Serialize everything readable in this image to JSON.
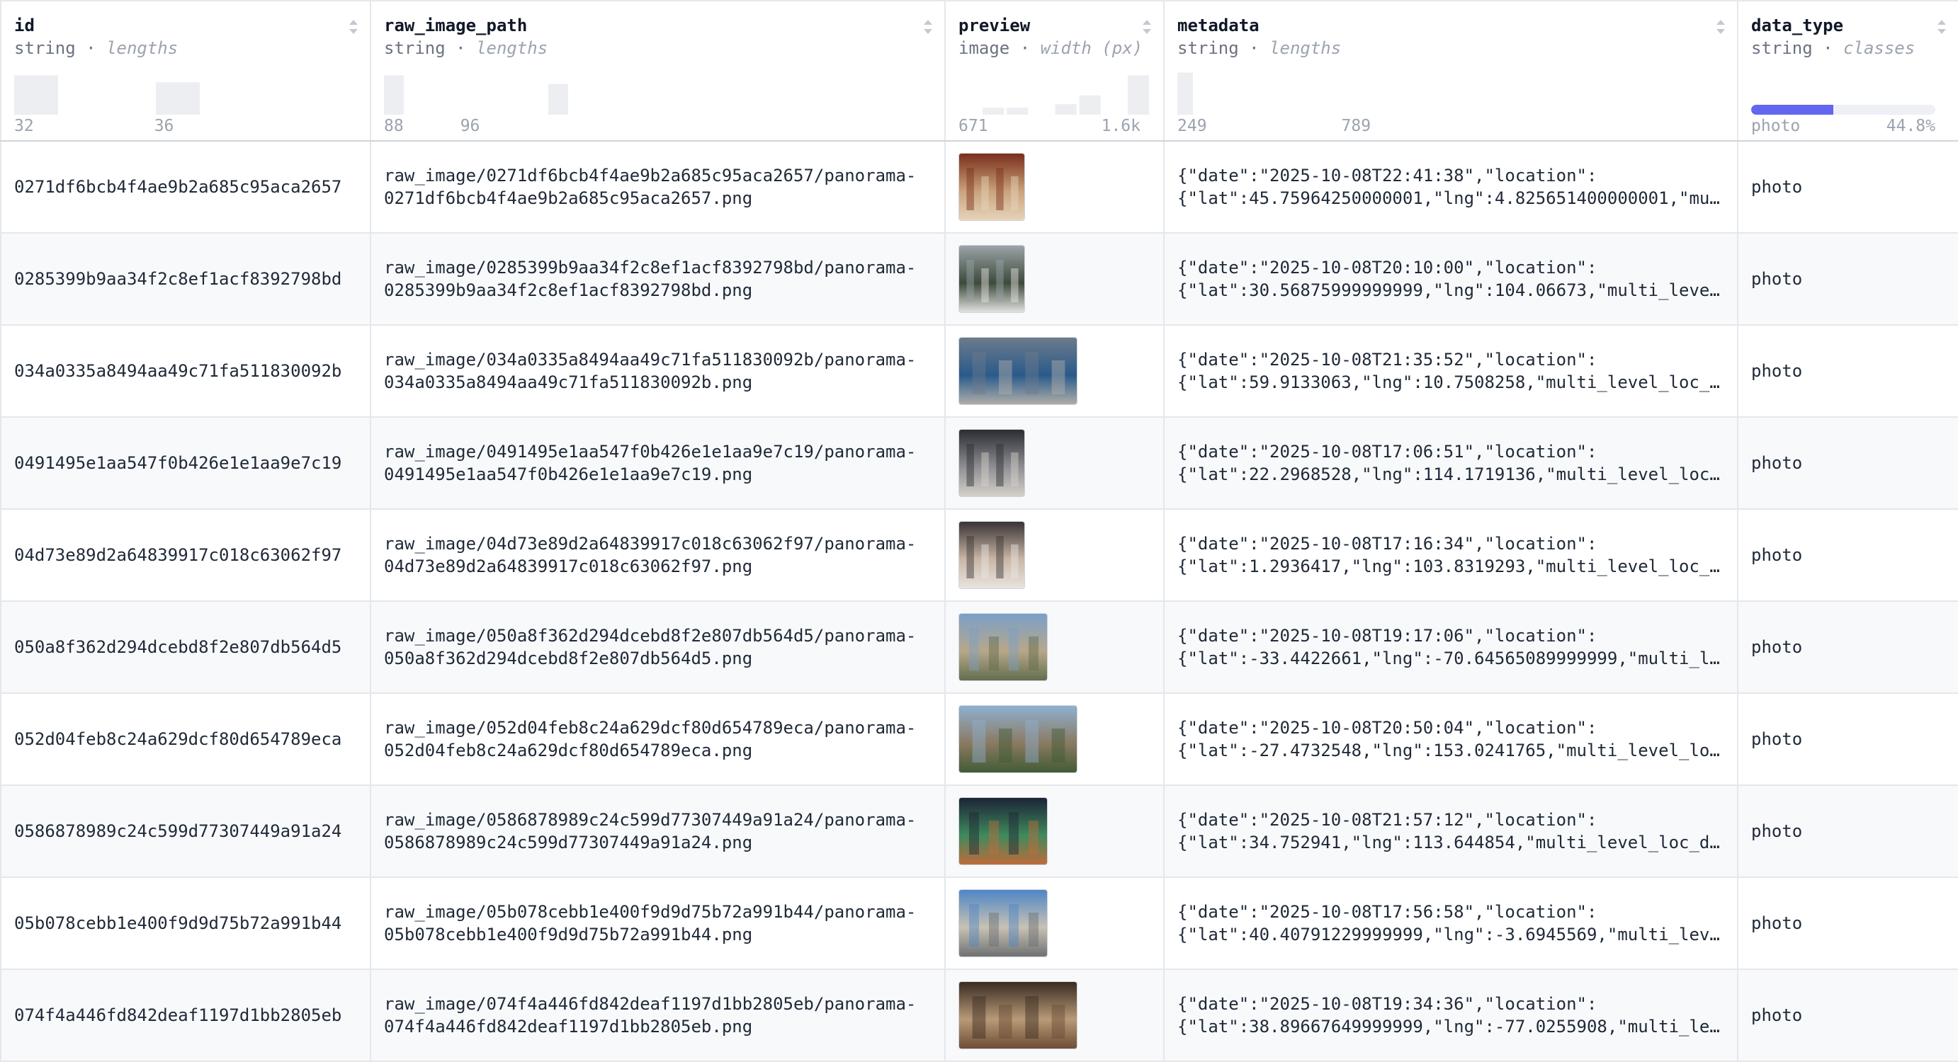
{
  "columns": [
    {
      "name": "id",
      "type": "string",
      "stat": "lengths",
      "min": "32",
      "max": "36"
    },
    {
      "name": "raw_image_path",
      "type": "string",
      "stat": "lengths",
      "min": "88",
      "max": "96"
    },
    {
      "name": "preview",
      "type": "image",
      "stat": "width (px)",
      "min": "671",
      "max": "1.6k"
    },
    {
      "name": "metadata",
      "type": "string",
      "stat": "lengths",
      "min": "249",
      "max": "789"
    },
    {
      "name": "data_type",
      "type": "string",
      "stat": "classes",
      "min": "photo",
      "max": "44.8%",
      "fraction": 0.448
    }
  ],
  "histograms": {
    "id": [
      0.45,
      0.0,
      0.0,
      0.0,
      0.0,
      0.0,
      0.0,
      0.37
    ],
    "raw_image_path": [
      0.45,
      0.0,
      0.0,
      0.0,
      0.0,
      0.0,
      0.0,
      0.0,
      0.0,
      0.35
    ],
    "preview": [
      0.0,
      0.08,
      0.08,
      0.0,
      0.12,
      0.22,
      0.0,
      0.45
    ],
    "metadata": [
      0.48
    ]
  },
  "rows": [
    {
      "id": "0271df6bcb4f4ae9b2a685c95aca2657",
      "path_1": "raw_image/0271df6bcb4f4ae9b2a685c95aca2657/panorama-",
      "path_2": "0271df6bcb4f4ae9b2a685c95aca2657.png",
      "meta_1": "{\"date\":\"2025-10-08T22:41:38\",\"location\":",
      "meta_2": "{\"lat\":45.75964250000001,\"lng\":4.825651400000001,\"mu…",
      "type": "photo",
      "thumb_w": 0.56,
      "thumb_colors": [
        "#7a2e1c",
        "#c9a27a",
        "#e7d6bd"
      ]
    },
    {
      "id": "0285399b9aa34f2c8ef1acf8392798bd",
      "path_1": "raw_image/0285399b9aa34f2c8ef1acf8392798bd/panorama-",
      "path_2": "0285399b9aa34f2c8ef1acf8392798bd.png",
      "meta_1": "{\"date\":\"2025-10-08T20:10:00\",\"location\":",
      "meta_2": "{\"lat\":30.56875999999999,\"lng\":104.06673,\"multi_leve…",
      "type": "photo",
      "thumb_w": 0.56,
      "thumb_colors": [
        "#9aa3a8",
        "#3d4a3a",
        "#e8e9e6"
      ]
    },
    {
      "id": "034a0335a8494aa49c71fa511830092b",
      "path_1": "raw_image/034a0335a8494aa49c71fa511830092b/panorama-",
      "path_2": "034a0335a8494aa49c71fa511830092b.png",
      "meta_1": "{\"date\":\"2025-10-08T21:35:52\",\"location\":",
      "meta_2": "{\"lat\":59.9133063,\"lng\":10.7508258,\"multi_level_loc_…",
      "type": "photo",
      "thumb_w": 1.0,
      "thumb_colors": [
        "#6c7b8c",
        "#2a5a8a",
        "#b5b1aa"
      ]
    },
    {
      "id": "0491495e1aa547f0b426e1e1aa9e7c19",
      "path_1": "raw_image/0491495e1aa547f0b426e1e1aa9e7c19/panorama-",
      "path_2": "0491495e1aa547f0b426e1e1aa9e7c19.png",
      "meta_1": "{\"date\":\"2025-10-08T17:06:51\",\"location\":",
      "meta_2": "{\"lat\":22.2968528,\"lng\":114.1719136,\"multi_level_loc…",
      "type": "photo",
      "thumb_w": 0.56,
      "thumb_colors": [
        "#2b2d33",
        "#8f8f93",
        "#d7d3cc"
      ]
    },
    {
      "id": "04d73e89d2a64839917c018c63062f97",
      "path_1": "raw_image/04d73e89d2a64839917c018c63062f97/panorama-",
      "path_2": "04d73e89d2a64839917c018c63062f97.png",
      "meta_1": "{\"date\":\"2025-10-08T17:16:34\",\"location\":",
      "meta_2": "{\"lat\":1.2936417,\"lng\":103.8319293,\"multi_level_loc_…",
      "type": "photo",
      "thumb_w": 0.56,
      "thumb_colors": [
        "#3a3335",
        "#c9b7a6",
        "#eae6e1"
      ]
    },
    {
      "id": "050a8f362d294dcebd8f2e807db564d5",
      "path_1": "raw_image/050a8f362d294dcebd8f2e807db564d5/panorama-",
      "path_2": "050a8f362d294dcebd8f2e807db564d5.png",
      "meta_1": "{\"date\":\"2025-10-08T19:17:06\",\"location\":",
      "meta_2": "{\"lat\":-33.4422661,\"lng\":-70.64565089999999,\"multi_l…",
      "type": "photo",
      "thumb_w": 0.75,
      "thumb_colors": [
        "#7aa0c8",
        "#b8a78a",
        "#5f6b4a"
      ]
    },
    {
      "id": "052d04feb8c24a629dcf80d654789eca",
      "path_1": "raw_image/052d04feb8c24a629dcf80d654789eca/panorama-",
      "path_2": "052d04feb8c24a629dcf80d654789eca.png",
      "meta_1": "{\"date\":\"2025-10-08T20:50:04\",\"location\":",
      "meta_2": "{\"lat\":-27.4732548,\"lng\":153.0241765,\"multi_level_lo…",
      "type": "photo",
      "thumb_w": 1.0,
      "thumb_colors": [
        "#8fb0cf",
        "#8a7a62",
        "#3f5a34"
      ]
    },
    {
      "id": "0586878989c24c599d77307449a91a24",
      "path_1": "raw_image/0586878989c24c599d77307449a91a24/panorama-",
      "path_2": "0586878989c24c599d77307449a91a24.png",
      "meta_1": "{\"date\":\"2025-10-08T21:57:12\",\"location\":",
      "meta_2": "{\"lat\":34.752941,\"lng\":113.644854,\"multi_level_loc_d…",
      "type": "photo",
      "thumb_w": 0.75,
      "thumb_colors": [
        "#1c2336",
        "#3f8a5c",
        "#c46a3a"
      ]
    },
    {
      "id": "05b078cebb1e400f9d9d75b72a991b44",
      "path_1": "raw_image/05b078cebb1e400f9d9d75b72a991b44/panorama-",
      "path_2": "05b078cebb1e400f9d9d75b72a991b44.png",
      "meta_1": "{\"date\":\"2025-10-08T17:56:58\",\"location\":",
      "meta_2": "{\"lat\":40.40791229999999,\"lng\":-3.6945569,\"multi_lev…",
      "type": "photo",
      "thumb_w": 0.75,
      "thumb_colors": [
        "#4f86c6",
        "#c8c2b4",
        "#6a6d70"
      ]
    },
    {
      "id": "074f4a446fd842deaf1197d1bb2805eb",
      "path_1": "raw_image/074f4a446fd842deaf1197d1bb2805eb/panorama-",
      "path_2": "074f4a446fd842deaf1197d1bb2805eb.png",
      "meta_1": "{\"date\":\"2025-10-08T19:34:36\",\"location\":",
      "meta_2": "{\"lat\":38.89667649999999,\"lng\":-77.0255908,\"multi_le…",
      "type": "photo",
      "thumb_w": 1.0,
      "thumb_colors": [
        "#3a2b22",
        "#b89a78",
        "#6b4a32"
      ]
    }
  ]
}
